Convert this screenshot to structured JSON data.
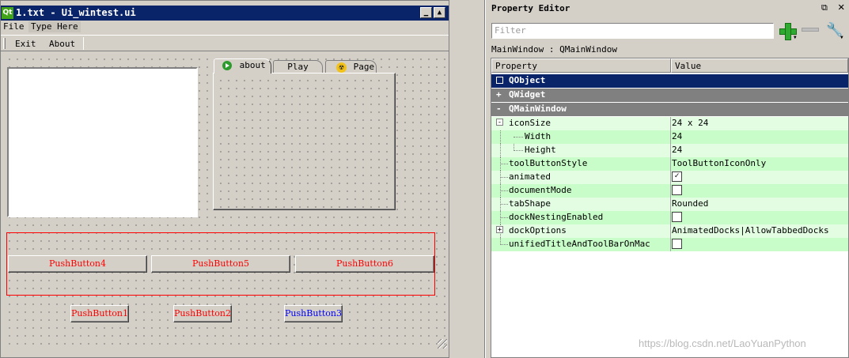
{
  "designer": {
    "title": "1.txt - Ui_wintest.ui",
    "menu": {
      "file": "File",
      "type_here": "Type Here"
    },
    "toolbar": {
      "exit": "Exit",
      "about": "About"
    },
    "tabs": {
      "about": "about",
      "play": "Play",
      "page": "Page"
    },
    "layout_buttons": {
      "b4": "PushButton4",
      "b5": "PushButton5",
      "b6": "PushButton6"
    },
    "buttons": {
      "b1": "PushButton1",
      "b2": "PushButton2",
      "b3": "PushButton3"
    }
  },
  "property_editor": {
    "title": "Property Editor",
    "filter_placeholder": "Filter",
    "object_label": "MainWindow : QMainWindow",
    "header": {
      "property": "Property",
      "value": "Value"
    },
    "groups": {
      "qobject": "QObject",
      "qwidget": "QWidget",
      "qmainwindow": "QMainWindow"
    },
    "props": {
      "iconSize": {
        "name": "iconSize",
        "value": "24 x 24"
      },
      "width": {
        "name": "Width",
        "value": "24"
      },
      "height": {
        "name": "Height",
        "value": "24"
      },
      "toolButtonStyle": {
        "name": "toolButtonStyle",
        "value": "ToolButtonIconOnly"
      },
      "animated": {
        "name": "animated",
        "checked": true
      },
      "documentMode": {
        "name": "documentMode",
        "checked": false
      },
      "tabShape": {
        "name": "tabShape",
        "value": "Rounded"
      },
      "dockNestingEnabled": {
        "name": "dockNestingEnabled",
        "checked": false
      },
      "dockOptions": {
        "name": "dockOptions",
        "value": "AnimatedDocks|AllowTabbedDocks"
      },
      "unifiedTitleAndToolBarOnMac": {
        "name": "unifiedTitleAndToolBarOnMac",
        "checked": false
      }
    }
  },
  "watermark": "https://blog.csdn.net/LaoYuanPython",
  "colors": {
    "titlebar": "#0a246a",
    "group_dark": "#0a246a",
    "group_grey": "#808080",
    "prop_light": "#e2fde2",
    "prop_mid": "#c8fcc8",
    "button_red": "#ff0000",
    "button_blue": "#0000ff"
  }
}
